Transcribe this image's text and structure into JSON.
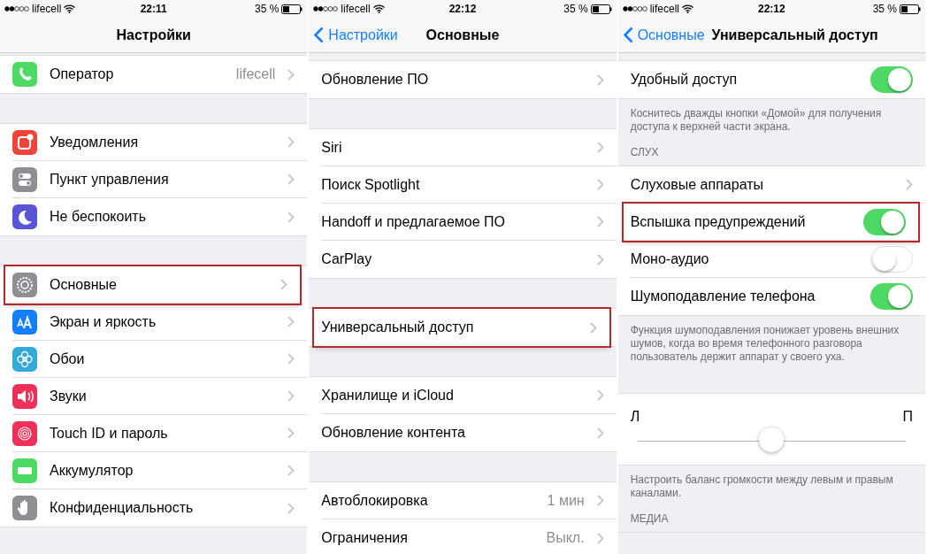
{
  "screens": [
    {
      "status": {
        "carrier": "lifecell",
        "time": "22:11",
        "battery": "35 %"
      },
      "nav": {
        "title": "Настройки"
      },
      "groups": [
        {
          "rows": [
            {
              "kind": "link",
              "label": "Оператор",
              "value": "lifecell",
              "color": "#4cd964",
              "highlighted": false
            }
          ]
        },
        {
          "rows": [
            {
              "kind": "link",
              "label": "Уведомления",
              "color": "#f0443a",
              "highlighted": false
            },
            {
              "kind": "link",
              "label": "Пункт управления",
              "color": "#8e8e93",
              "highlighted": false
            },
            {
              "kind": "link",
              "label": "Не беспокоить",
              "color": "#5856d6",
              "highlighted": false
            }
          ]
        },
        {
          "rows": [
            {
              "kind": "link",
              "label": "Основные",
              "color": "#8e8e93",
              "highlighted": true
            },
            {
              "kind": "link",
              "label": "Экран и яркость",
              "color": "#147efb",
              "highlighted": false
            },
            {
              "kind": "link",
              "label": "Обои",
              "color": "#34aadc",
              "highlighted": false
            },
            {
              "kind": "link",
              "label": "Звуки",
              "color": "#f0305a",
              "highlighted": false
            },
            {
              "kind": "link",
              "label": "Touch ID и пароль",
              "color": "#f0305a",
              "highlighted": false
            },
            {
              "kind": "link",
              "label": "Аккумулятор",
              "color": "#4cd964",
              "highlighted": false
            },
            {
              "kind": "link",
              "label": "Конфиденциальность",
              "color": "#8e8e93",
              "highlighted": false
            }
          ]
        }
      ]
    },
    {
      "status": {
        "carrier": "lifecell",
        "time": "22:12",
        "battery": "35 %"
      },
      "nav": {
        "back": "Настройки",
        "title": "Основные"
      },
      "groups": [
        {
          "rows": [
            {
              "kind": "link",
              "label": "Обновление ПО",
              "highlighted": false
            }
          ]
        },
        {
          "rows": [
            {
              "kind": "link",
              "label": "Siri",
              "highlighted": false
            },
            {
              "kind": "link",
              "label": "Поиск Spotlight",
              "highlighted": false
            },
            {
              "kind": "link",
              "label": "Handoff и предлагаемое ПО",
              "highlighted": false
            },
            {
              "kind": "link",
              "label": "CarPlay",
              "highlighted": false
            }
          ]
        },
        {
          "rows": [
            {
              "kind": "link",
              "label": "Универсальный доступ",
              "highlighted": true
            }
          ]
        },
        {
          "rows": [
            {
              "kind": "link",
              "label": "Хранилище и iCloud",
              "highlighted": false
            },
            {
              "kind": "link",
              "label": "Обновление контента",
              "highlighted": false
            }
          ]
        },
        {
          "rows": [
            {
              "kind": "link",
              "label": "Автоблокировка",
              "value": "1 мин",
              "highlighted": false
            },
            {
              "kind": "link",
              "label": "Ограничения",
              "value": "Выкл.",
              "highlighted": false
            }
          ]
        }
      ]
    },
    {
      "status": {
        "carrier": "lifecell",
        "time": "22:12",
        "battery": "35 %"
      },
      "nav": {
        "back": "Основные",
        "title": "Универсальный доступ"
      },
      "groups": [
        {
          "rows": [
            {
              "kind": "toggle",
              "label": "Удобный доступ",
              "on": true,
              "highlighted": false
            }
          ],
          "footer": "Коснитесь дважды кнопки «Домой» для получения доступа к верхней части экрана."
        },
        {
          "header": "СЛУХ",
          "rows": [
            {
              "kind": "link",
              "label": "Слуховые аппараты",
              "highlighted": false
            },
            {
              "kind": "toggle",
              "label": "Вспышка предупреждений",
              "on": true,
              "highlighted": true
            },
            {
              "kind": "toggle",
              "label": "Моно-аудио",
              "on": false,
              "highlighted": false
            },
            {
              "kind": "toggle",
              "label": "Шумоподавление телефона",
              "on": true,
              "highlighted": false
            }
          ],
          "footer": "Функция шумоподавления понижает уровень внешних шумов, когда во время телефонного разговора пользователь держит аппарат у своего уха."
        },
        {
          "rows": [
            {
              "kind": "slider",
              "left": "Л",
              "right": "П",
              "level": 0.5
            }
          ],
          "footer": "Настроить баланс громкости между левым и правым каналами."
        },
        {
          "header": "МЕДИА"
        }
      ]
    }
  ]
}
